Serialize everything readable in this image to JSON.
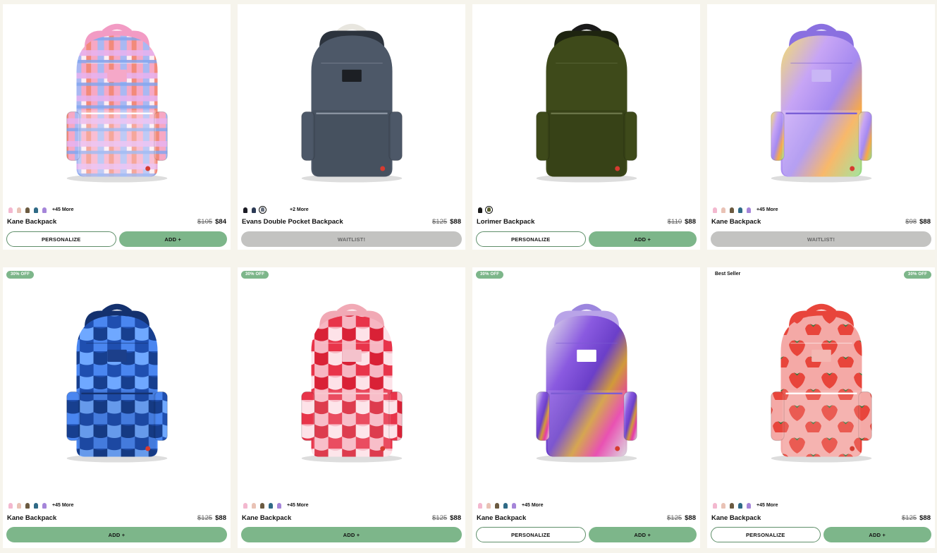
{
  "colors": {
    "accent": "#7db68a",
    "background": "#f6f4ec",
    "waitlist": "#c3c3c1"
  },
  "swatch_sets": {
    "kane": [
      "#f3b8cf",
      "#e9c2b5",
      "#6b5a40",
      "#2f6a86",
      "#a585d9"
    ],
    "evans": [
      "#1b1b24",
      "#2c3a55",
      "#6a7280"
    ],
    "lorimer": [
      "#1a1a1a",
      "#5a5f30"
    ]
  },
  "products": [
    {
      "name": "Kane Backpack",
      "price_was": "$105",
      "price": "$84",
      "more": "+45 More",
      "swatches": "kane",
      "selected": -1,
      "badge": "",
      "best": "",
      "btns": [
        {
          "kind": "outline",
          "label": "PERSONALIZE"
        },
        {
          "kind": "add",
          "label": "ADD +"
        }
      ],
      "art": "plaid"
    },
    {
      "name": "Evans Double Pocket Backpack",
      "price_was": "$125",
      "price": "$88",
      "more": "+2 More",
      "swatches": "evans",
      "selected": 2,
      "badge": "",
      "best": "",
      "btns": [
        {
          "kind": "wait",
          "label": "WAITLIST!"
        }
      ],
      "art": "evans"
    },
    {
      "name": "Lorimer Backpack",
      "price_was": "$110",
      "price": "$88",
      "more": "",
      "swatches": "lorimer",
      "selected": 1,
      "badge": "",
      "best": "",
      "btns": [
        {
          "kind": "outline",
          "label": "PERSONALIZE"
        },
        {
          "kind": "add",
          "label": "ADD +"
        }
      ],
      "art": "lorimer"
    },
    {
      "name": "Kane Backpack",
      "price_was": "$98",
      "price": "$88",
      "more": "+45 More",
      "swatches": "kane",
      "selected": -1,
      "badge": "",
      "best": "",
      "btns": [
        {
          "kind": "wait",
          "label": "WAITLIST!"
        }
      ],
      "art": "rainbow"
    },
    {
      "name": "Kane Backpack",
      "price_was": "$125",
      "price": "$88",
      "more": "+45 More",
      "swatches": "kane",
      "selected": -1,
      "badge": "30% OFF",
      "best": "",
      "btns": [
        {
          "kind": "add",
          "label": "ADD +"
        }
      ],
      "art": "bluewave"
    },
    {
      "name": "Kane Backpack",
      "price_was": "$125",
      "price": "$88",
      "more": "+45 More",
      "swatches": "kane",
      "selected": -1,
      "badge": "30% OFF",
      "best": "",
      "btns": [
        {
          "kind": "add",
          "label": "ADD +"
        }
      ],
      "art": "redwave"
    },
    {
      "name": "Kane Backpack",
      "price_was": "$125",
      "price": "$88",
      "more": "+45 More",
      "swatches": "kane",
      "selected": -1,
      "badge": "30% OFF",
      "best": "",
      "btns": [
        {
          "kind": "outline",
          "label": "PERSONALIZE"
        },
        {
          "kind": "add",
          "label": "ADD +"
        }
      ],
      "art": "sequin"
    },
    {
      "name": "Kane Backpack",
      "price_was": "$125",
      "price": "$88",
      "more": "+45 More",
      "swatches": "kane",
      "selected": -1,
      "badge": "30% OFF",
      "best": "Best Seller",
      "btns": [
        {
          "kind": "outline",
          "label": "PERSONALIZE"
        },
        {
          "kind": "add",
          "label": "ADD +"
        }
      ],
      "art": "strawberry"
    }
  ]
}
